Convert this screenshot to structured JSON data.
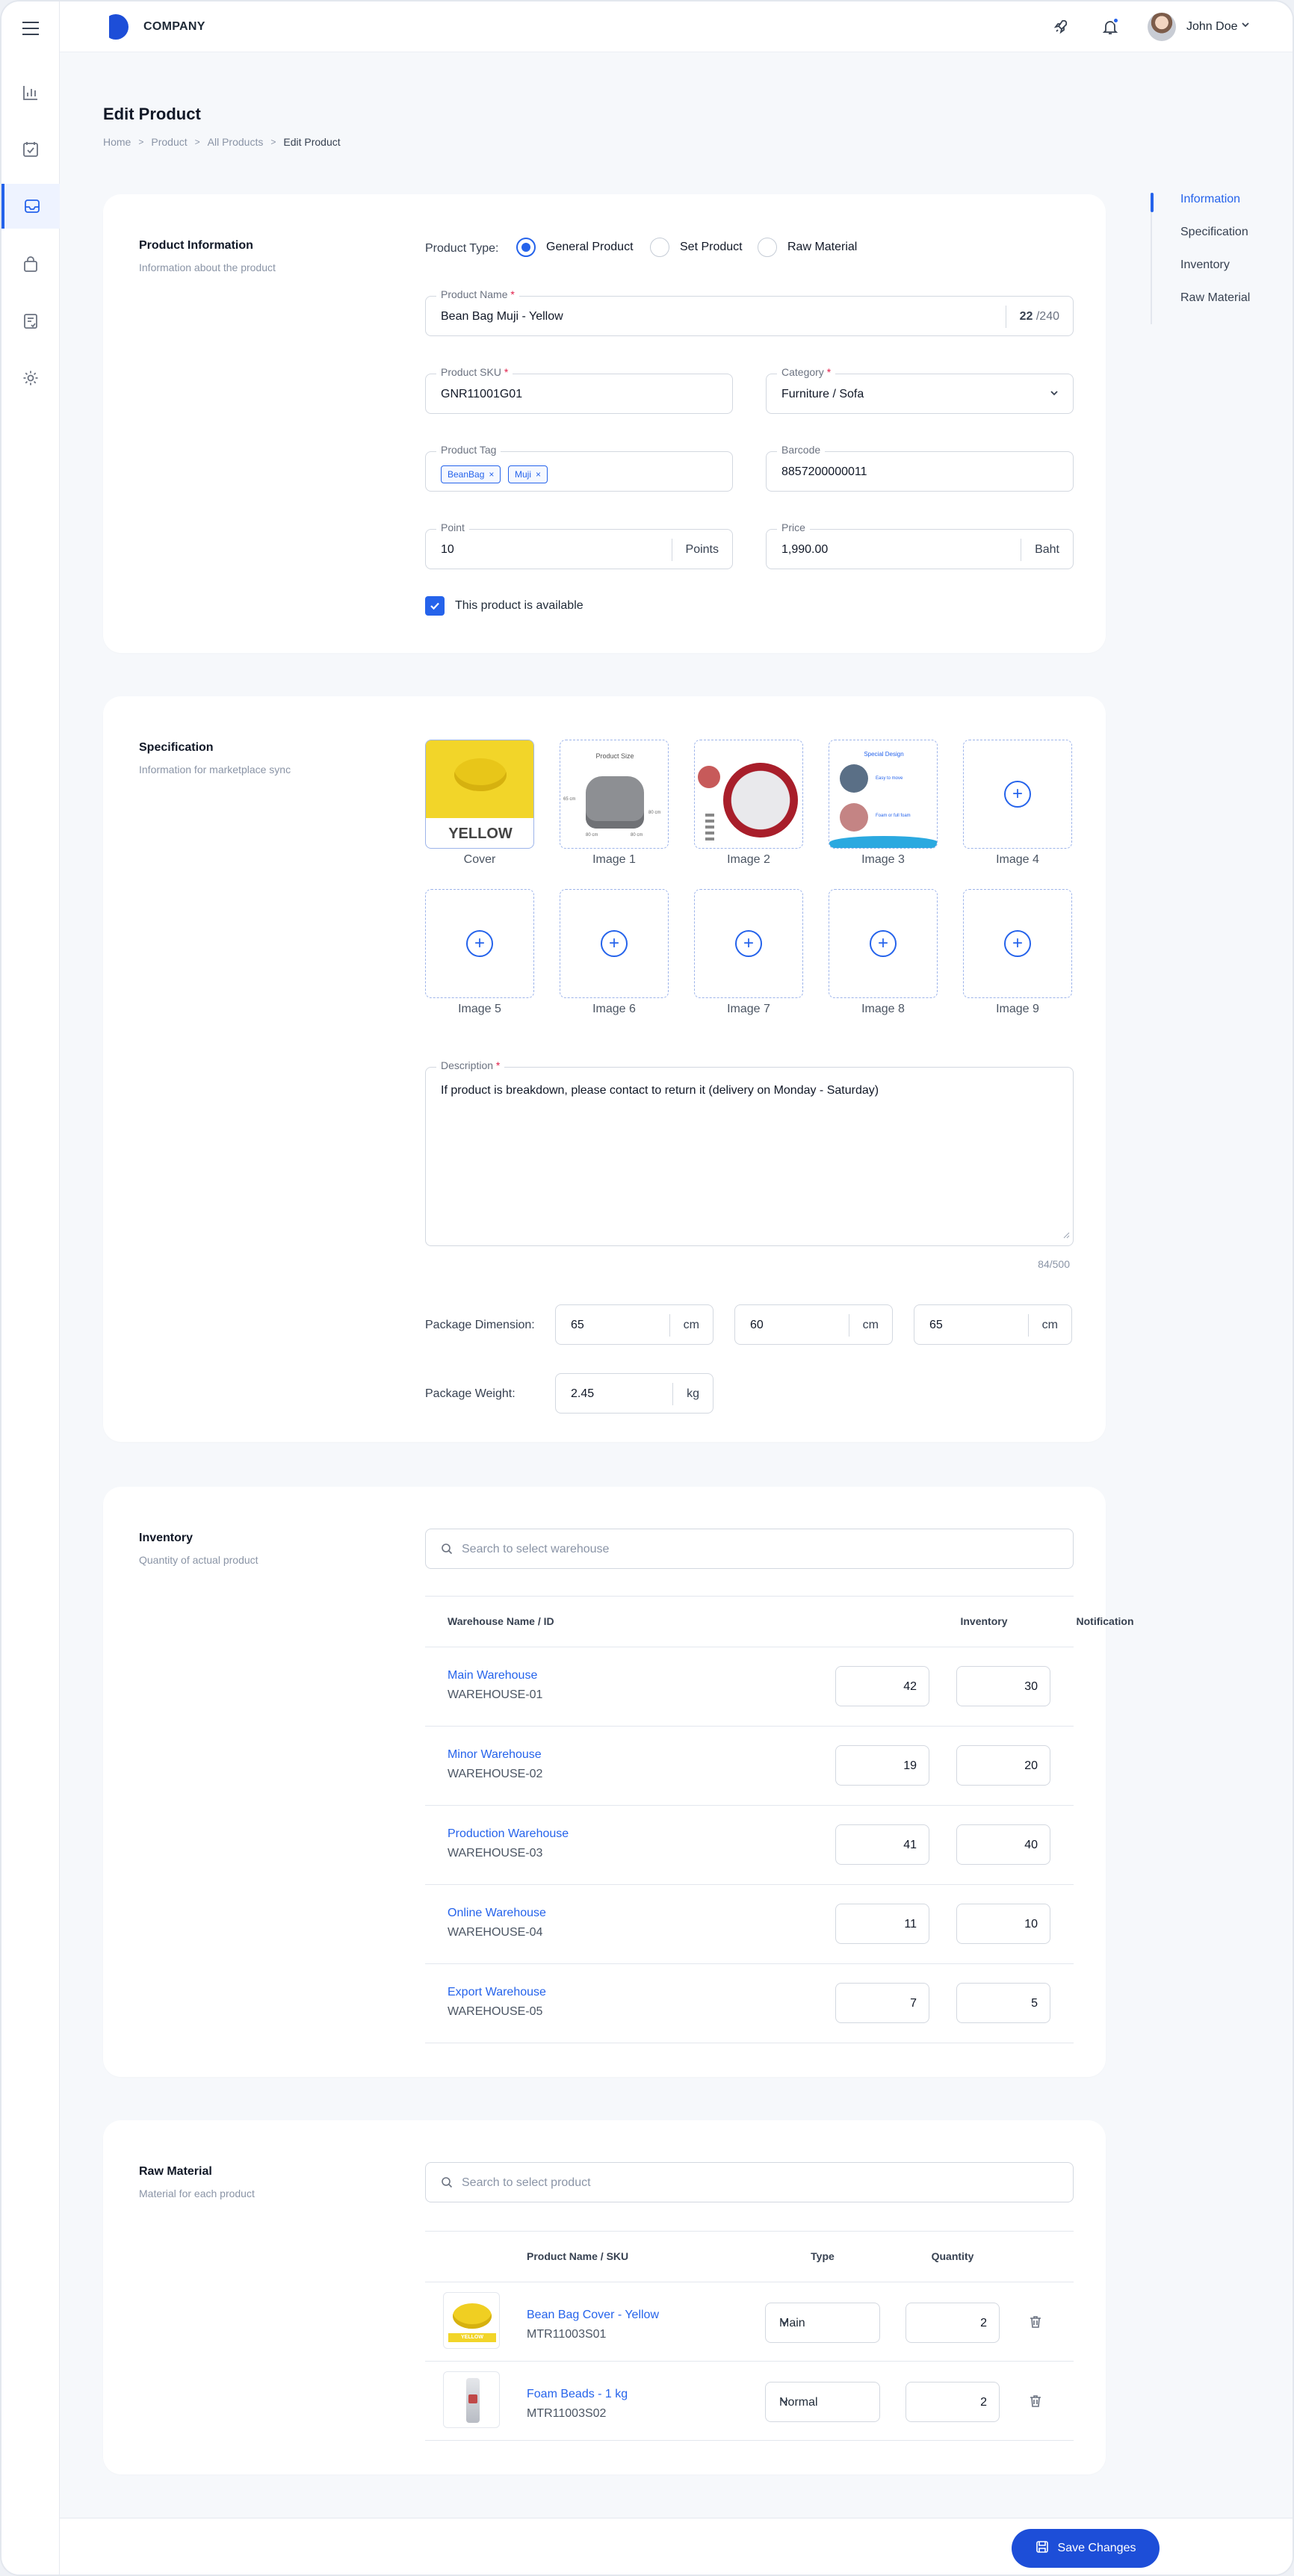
{
  "header": {
    "company": "COMPANY",
    "user_name": "John Doe"
  },
  "page": {
    "title": "Edit Product",
    "breadcrumb": [
      "Home",
      "Product",
      "All Products",
      "Edit Product"
    ]
  },
  "toc": [
    "Information",
    "Specification",
    "Inventory",
    "Raw Material"
  ],
  "info": {
    "title": "Product Information",
    "subtitle": "Information about the product",
    "type_label": "Product Type:",
    "types": [
      "General Product",
      "Set Product",
      "Raw Material"
    ],
    "selected_type": "General Product",
    "name_label": "Product Name",
    "name_value": "Bean Bag Muji - Yellow",
    "name_count": "22",
    "name_max": "/240",
    "sku_label": "Product SKU",
    "sku_value": "GNR11001G01",
    "category_label": "Category",
    "category_value": "Furniture / Sofa",
    "tag_label": "Product Tag",
    "tags": [
      "BeanBag",
      "Muji"
    ],
    "barcode_label": "Barcode",
    "barcode_value": "8857200000011",
    "point_label": "Point",
    "point_value": "10",
    "point_unit": "Points",
    "price_label": "Price",
    "price_value": "1,990.00",
    "price_unit": "Baht",
    "available_label": "This product is available",
    "available": true
  },
  "spec": {
    "title": "Specification",
    "subtitle": "Information for marketplace sync",
    "image_captions": [
      "Cover",
      "Image 1",
      "Image 2",
      "Image 3",
      "Image 4",
      "Image 5",
      "Image 6",
      "Image 7",
      "Image 8",
      "Image 9"
    ],
    "cover_text": "YELLOW",
    "image1_text": "Product Size",
    "image1_dims": [
      "80 cm",
      "80 cm",
      "80 cm",
      "65 cm"
    ],
    "image3_text": "Special Design",
    "image3_notes": [
      "Easy to move",
      "Foam or full foam"
    ],
    "desc_label": "Description",
    "desc_value": "If product is breakdown, please contact to return it  (delivery on Monday - Saturday)",
    "desc_count": "84/500",
    "dim_label": "Package Dimension:",
    "dims": [
      "65",
      "60",
      "65"
    ],
    "dim_unit": "cm",
    "weight_label": "Package Weight:",
    "weight": "2.45",
    "weight_unit": "kg"
  },
  "inventory": {
    "title": "Inventory",
    "subtitle": "Quantity of actual product",
    "search_placeholder": "Search to select warehouse",
    "columns": [
      "Warehouse Name / ID",
      "Inventory",
      "Notification"
    ],
    "rows": [
      {
        "name": "Main Warehouse",
        "id": "WAREHOUSE-01",
        "inventory": "42",
        "notification": "30"
      },
      {
        "name": "Minor Warehouse",
        "id": "WAREHOUSE-02",
        "inventory": "19",
        "notification": "20"
      },
      {
        "name": "Production Warehouse",
        "id": "WAREHOUSE-03",
        "inventory": "41",
        "notification": "40"
      },
      {
        "name": "Online Warehouse",
        "id": "WAREHOUSE-04",
        "inventory": "11",
        "notification": "10"
      },
      {
        "name": "Export Warehouse",
        "id": "WAREHOUSE-05",
        "inventory": "7",
        "notification": "5"
      }
    ]
  },
  "raw": {
    "title": "Raw Material",
    "subtitle": "Material for each product",
    "search_placeholder": "Search to select product",
    "columns": [
      "Product Name / SKU",
      "Type",
      "Quantity"
    ],
    "rows": [
      {
        "name": "Bean Bag Cover - Yellow",
        "sku": "MTR11003S01",
        "type": "Main",
        "quantity": "2",
        "thumb_text": "YELLOW"
      },
      {
        "name": "Foam Beads - 1 kg",
        "sku": "MTR11003S02",
        "type": "Normal",
        "quantity": "2"
      }
    ]
  },
  "footer": {
    "save_label": "Save Changes"
  },
  "colors": {
    "accent": "#2563eb",
    "page_bg": "#f6f8fb",
    "required": "#e11d48"
  },
  "icons": [
    "menu-icon",
    "chart-icon",
    "checklist-icon",
    "inbox-icon",
    "bag-icon",
    "report-icon",
    "gear-icon",
    "rocket-icon",
    "bell-icon",
    "chevron-down-icon",
    "search-icon",
    "plus-icon",
    "trash-icon",
    "save-icon",
    "check-icon"
  ]
}
